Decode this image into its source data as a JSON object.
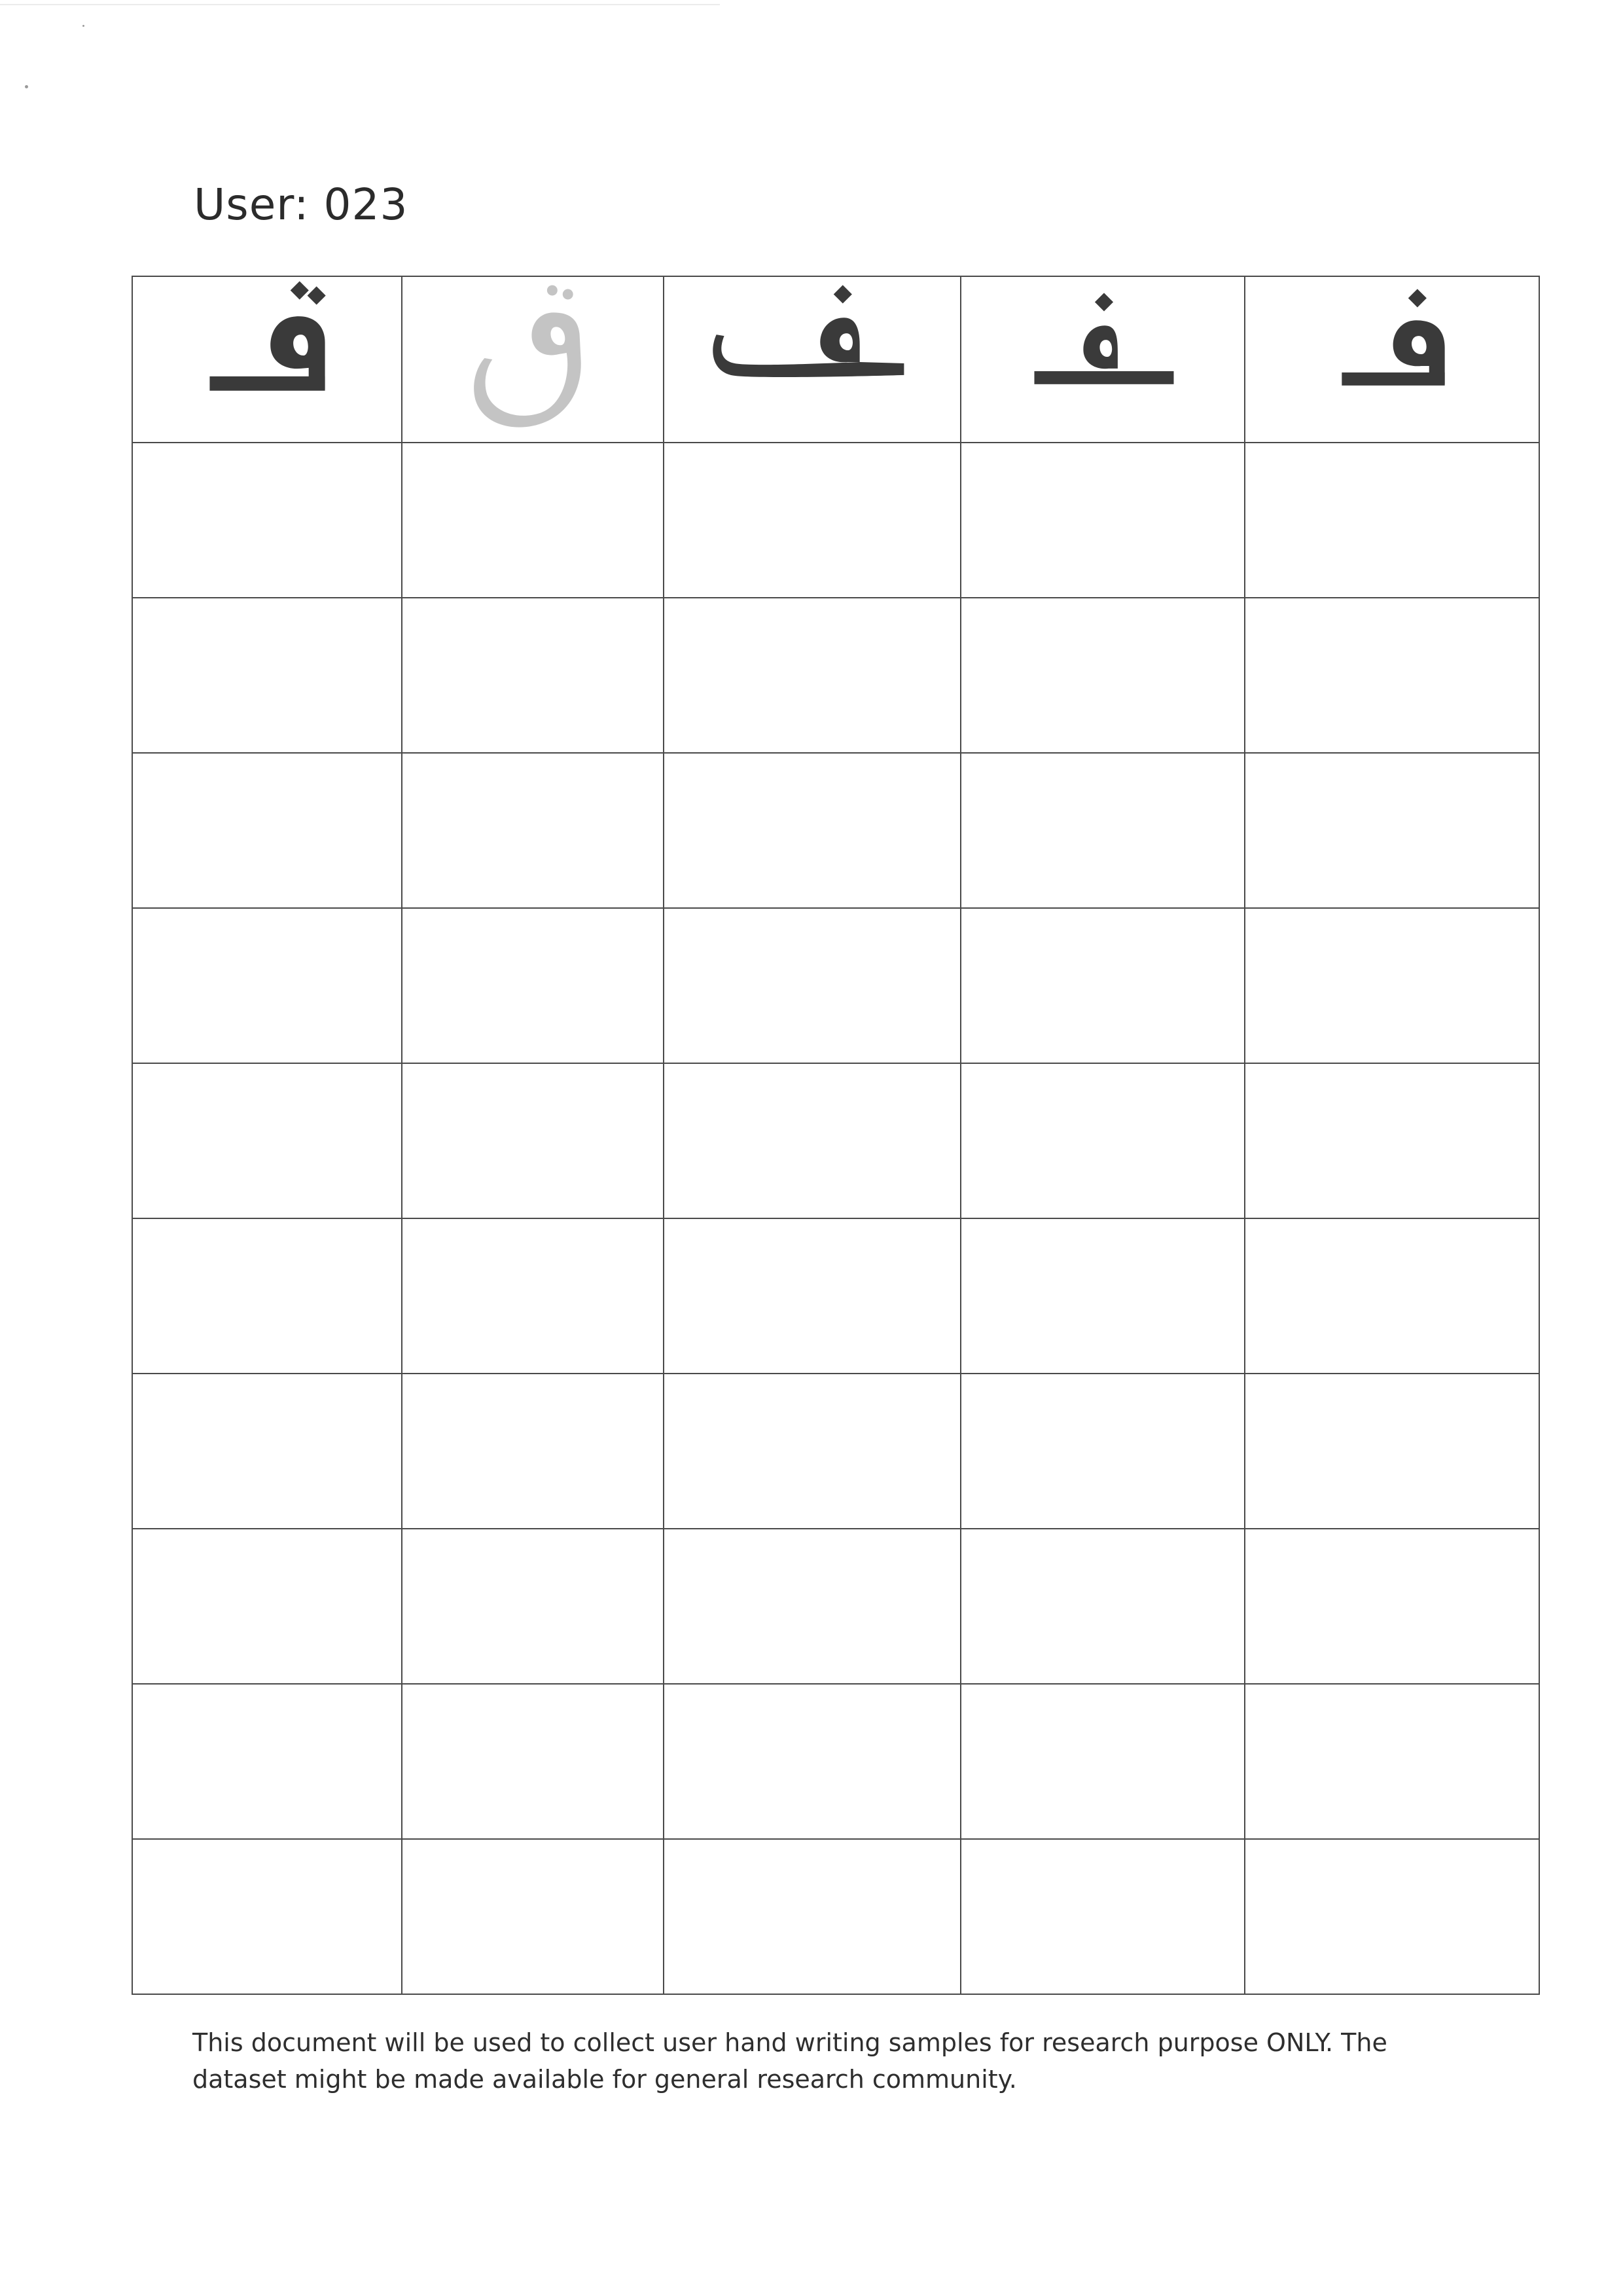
{
  "header": {
    "user_label": "User: 023"
  },
  "worksheet": {
    "letter_forms": [
      {
        "name": "isolated-qaf-form",
        "color": "#3a3a3a"
      },
      {
        "name": "qaf-outline-form",
        "color": "#c4c4c4"
      },
      {
        "name": "final-fa-form",
        "color": "#3a3a3a"
      },
      {
        "name": "medial-fa-form",
        "color": "#3a3a3a"
      },
      {
        "name": "initial-fa-form",
        "color": "#3a3a3a"
      }
    ],
    "blank_rows": 10,
    "columns": 5
  },
  "footer": {
    "disclaimer": "This document will be used to collect user hand writing samples for research purpose ONLY. The dataset might be made available for general research community."
  }
}
